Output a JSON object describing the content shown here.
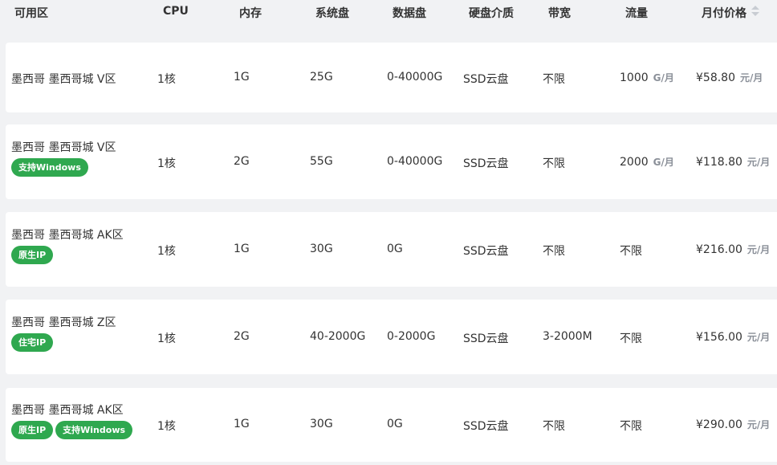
{
  "table": {
    "columns": [
      "可用区",
      "CPU",
      "内存",
      "系统盘",
      "数据盘",
      "硬盘介质",
      "带宽",
      "流量",
      "月付价格"
    ],
    "rows": [
      {
        "zone": "墨西哥 墨西哥城 V区",
        "badges": [],
        "cpu": "1核",
        "memory": "1G",
        "system_disk": "25G",
        "data_disk": "0-40000G",
        "medium": "SSD云盘",
        "bandwidth": "不限",
        "traffic": "1000",
        "traffic_unit": "G/月",
        "price": "¥58.80",
        "price_unit": "元/月"
      },
      {
        "zone": "墨西哥 墨西哥城 V区",
        "badges": [
          "支持Windows"
        ],
        "cpu": "1核",
        "memory": "2G",
        "system_disk": "55G",
        "data_disk": "0-40000G",
        "medium": "SSD云盘",
        "bandwidth": "不限",
        "traffic": "2000",
        "traffic_unit": "G/月",
        "price": "¥118.80",
        "price_unit": "元/月"
      },
      {
        "zone": "墨西哥 墨西哥城 AK区",
        "badges": [
          "原生IP"
        ],
        "cpu": "1核",
        "memory": "1G",
        "system_disk": "30G",
        "data_disk": "0G",
        "medium": "SSD云盘",
        "bandwidth": "不限",
        "traffic": "不限",
        "traffic_unit": "",
        "price": "¥216.00",
        "price_unit": "元/月"
      },
      {
        "zone": "墨西哥 墨西哥城 Z区",
        "badges": [
          "住宅IP"
        ],
        "cpu": "1核",
        "memory": "2G",
        "system_disk": "40-2000G",
        "data_disk": "0-2000G",
        "medium": "SSD云盘",
        "bandwidth": "3-2000M",
        "traffic": "不限",
        "traffic_unit": "",
        "price": "¥156.00",
        "price_unit": "元/月"
      },
      {
        "zone": "墨西哥 墨西哥城 AK区",
        "badges": [
          "原生IP",
          "支持Windows"
        ],
        "cpu": "1核",
        "memory": "1G",
        "system_disk": "30G",
        "data_disk": "0G",
        "medium": "SSD云盘",
        "bandwidth": "不限",
        "traffic": "不限",
        "traffic_unit": "",
        "price": "¥290.00",
        "price_unit": "元/月"
      }
    ]
  },
  "icons": {
    "sort": "sort-icon"
  },
  "colors": {
    "badge": "#2fa84f",
    "row_bg": "#ffffff",
    "page_bg": "#f1f2f4",
    "unit": "#8a8f98"
  }
}
